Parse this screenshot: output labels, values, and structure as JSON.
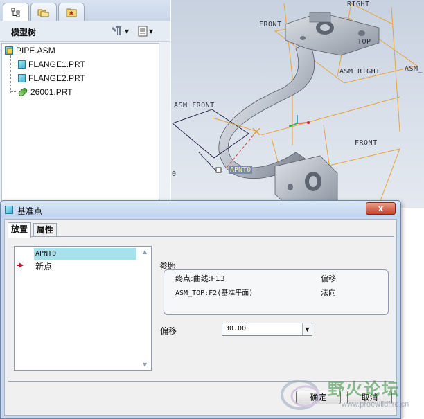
{
  "tree": {
    "title": "模型树",
    "nodes": [
      {
        "label": "PIPE.ASM",
        "icon": "assembly-icon"
      },
      {
        "label": "FLANGE1.PRT",
        "icon": "part-icon"
      },
      {
        "label": "FLANGE2.PRT",
        "icon": "part-icon"
      },
      {
        "label": "26001.PRT",
        "icon": "skeleton-part-icon"
      }
    ]
  },
  "viewport": {
    "labels": {
      "right": "RIGHT",
      "front_top": "FRONT",
      "top": "TOP",
      "asm_right": "ASM_RIGHT",
      "asm_right_edge": "ASM_",
      "asm_front": "ASM_FRONT",
      "front_bottom": "FRONT",
      "apnt": "APNT0",
      "zero": "0"
    }
  },
  "dialog": {
    "title": "基准点",
    "close": "x",
    "tabs": [
      "放置",
      "属性"
    ],
    "points": {
      "selected": "APNT0",
      "new_point": "新点"
    },
    "references": {
      "label": "参照",
      "rows": [
        {
          "ref": "终点:曲线:F13",
          "type": "偏移"
        },
        {
          "ref": "ASM_TOP:F2(基准平面)",
          "type": "法向"
        }
      ]
    },
    "offset": {
      "label": "偏移",
      "value": "30.00"
    },
    "ok": "确定",
    "cancel": "取消"
  },
  "watermark": {
    "text": "野火论坛",
    "url": "www.proewildfire.cn"
  },
  "colors": {
    "dialog_frame": "#c8d9ef",
    "selected_row": "#a7e1eb",
    "datum_orange": "#e8a23a",
    "close_red": "#c6432a"
  }
}
